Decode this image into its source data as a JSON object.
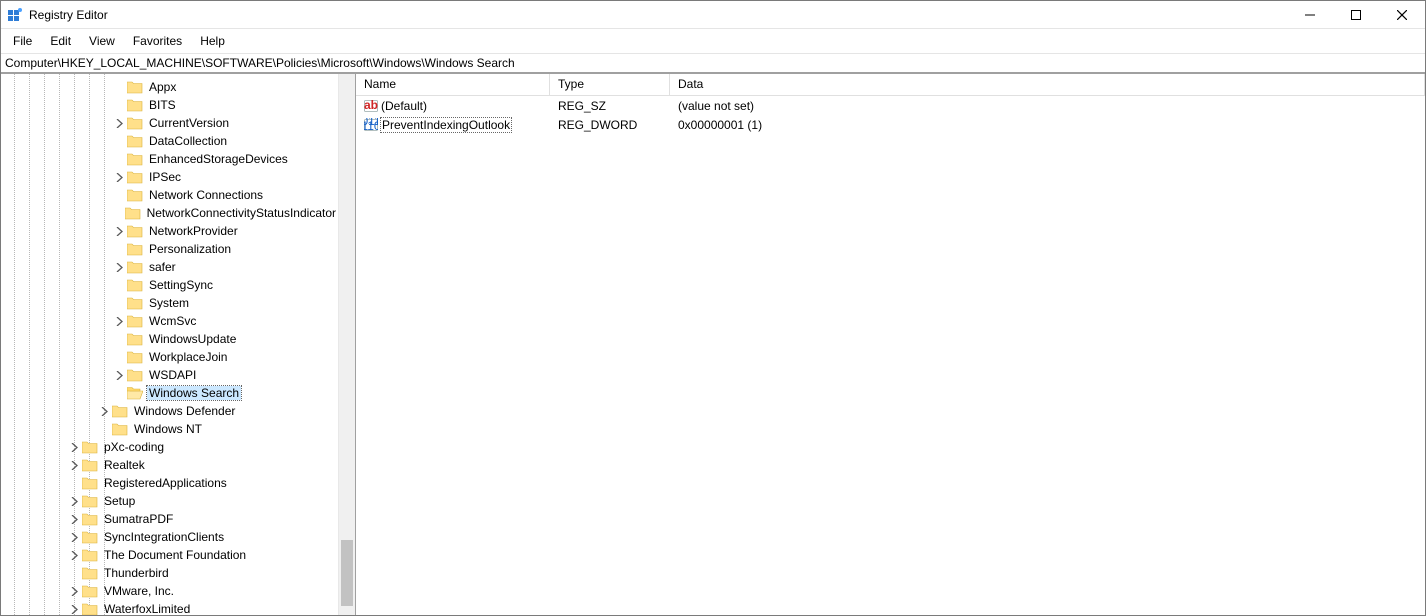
{
  "window": {
    "title": "Registry Editor"
  },
  "menu": {
    "file": "File",
    "edit": "Edit",
    "view": "View",
    "favorites": "Favorites",
    "help": "Help"
  },
  "address": {
    "path": "Computer\\HKEY_LOCAL_MACHINE\\SOFTWARE\\Policies\\Microsoft\\Windows\\Windows Search"
  },
  "tree": {
    "items": [
      {
        "indent": 7,
        "chev": false,
        "label": "Appx"
      },
      {
        "indent": 7,
        "chev": false,
        "label": "BITS"
      },
      {
        "indent": 7,
        "chev": true,
        "label": "CurrentVersion"
      },
      {
        "indent": 7,
        "chev": false,
        "label": "DataCollection"
      },
      {
        "indent": 7,
        "chev": false,
        "label": "EnhancedStorageDevices"
      },
      {
        "indent": 7,
        "chev": true,
        "label": "IPSec"
      },
      {
        "indent": 7,
        "chev": false,
        "label": "Network Connections"
      },
      {
        "indent": 7,
        "chev": false,
        "label": "NetworkConnectivityStatusIndicator"
      },
      {
        "indent": 7,
        "chev": true,
        "label": "NetworkProvider"
      },
      {
        "indent": 7,
        "chev": false,
        "label": "Personalization"
      },
      {
        "indent": 7,
        "chev": true,
        "label": "safer"
      },
      {
        "indent": 7,
        "chev": false,
        "label": "SettingSync"
      },
      {
        "indent": 7,
        "chev": false,
        "label": "System"
      },
      {
        "indent": 7,
        "chev": true,
        "label": "WcmSvc"
      },
      {
        "indent": 7,
        "chev": false,
        "label": "WindowsUpdate"
      },
      {
        "indent": 7,
        "chev": false,
        "label": "WorkplaceJoin"
      },
      {
        "indent": 7,
        "chev": true,
        "label": "WSDAPI"
      },
      {
        "indent": 7,
        "chev": false,
        "label": "Windows Search",
        "selected": true
      },
      {
        "indent": 6,
        "chev": true,
        "label": "Windows Defender"
      },
      {
        "indent": 6,
        "chev": false,
        "label": "Windows NT"
      },
      {
        "indent": 4,
        "chev": true,
        "label": "pXc-coding"
      },
      {
        "indent": 4,
        "chev": true,
        "label": "Realtek"
      },
      {
        "indent": 4,
        "chev": false,
        "label": "RegisteredApplications"
      },
      {
        "indent": 4,
        "chev": true,
        "label": "Setup"
      },
      {
        "indent": 4,
        "chev": true,
        "label": "SumatraPDF"
      },
      {
        "indent": 4,
        "chev": true,
        "label": "SyncIntegrationClients"
      },
      {
        "indent": 4,
        "chev": true,
        "label": "The Document Foundation"
      },
      {
        "indent": 4,
        "chev": false,
        "label": "Thunderbird"
      },
      {
        "indent": 4,
        "chev": true,
        "label": "VMware, Inc."
      },
      {
        "indent": 4,
        "chev": true,
        "label": "WaterfoxLimited"
      }
    ]
  },
  "list": {
    "headers": {
      "name": "Name",
      "type": "Type",
      "data": "Data"
    },
    "rows": [
      {
        "icon": "string",
        "name": "(Default)",
        "type": "REG_SZ",
        "data": "(value not set)"
      },
      {
        "icon": "binary",
        "name": "PreventIndexingOutlook",
        "type": "REG_DWORD",
        "data": "0x00000001 (1)",
        "focused": true
      }
    ]
  }
}
